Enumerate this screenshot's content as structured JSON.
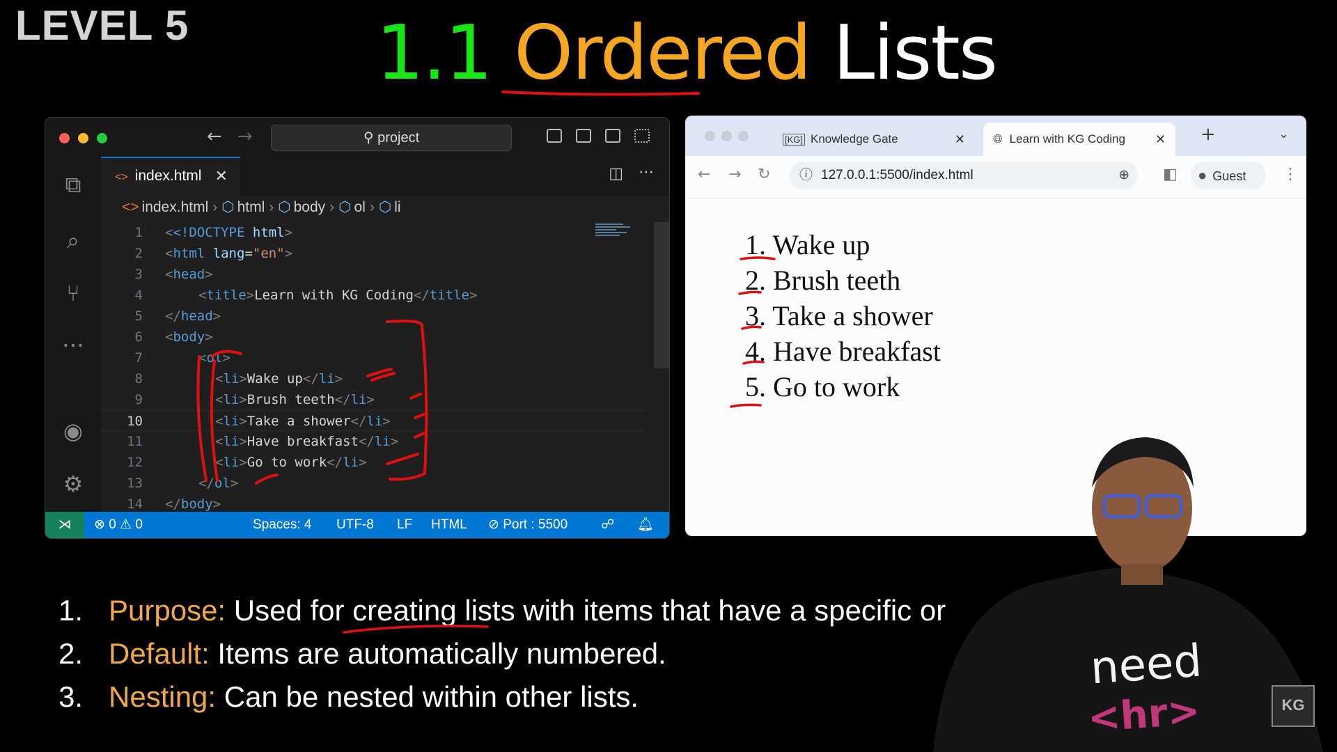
{
  "slide": {
    "level": "LEVEL 5",
    "title_number": "1.1",
    "title_word1": "Ordered",
    "title_word2": "Lists"
  },
  "editor": {
    "search_label": "project",
    "tab_label": "index.html",
    "breadcrumb": [
      "index.html",
      "html",
      "body",
      "ol",
      "li"
    ],
    "current_line": 10,
    "lines": [
      {
        "n": "1"
      },
      {
        "n": "2"
      },
      {
        "n": "3"
      },
      {
        "n": "4"
      },
      {
        "n": "5"
      },
      {
        "n": "6"
      },
      {
        "n": "7"
      },
      {
        "n": "8"
      },
      {
        "n": "9"
      },
      {
        "n": "10"
      },
      {
        "n": "11"
      },
      {
        "n": "12"
      },
      {
        "n": "13"
      },
      {
        "n": "14"
      }
    ],
    "code": {
      "doctype": "<!DOCTYPE",
      "doctype_html": "html",
      "html_open": "html",
      "lang_attr": "lang",
      "lang_val": "\"en\"",
      "head": "head",
      "title_tag": "title",
      "title_text": "Learn with KG Coding",
      "body": "body",
      "ol": "ol",
      "li": "li",
      "items": [
        "Wake up",
        "Brush teeth",
        "Take a shower",
        "Have breakfast",
        "Go to work"
      ]
    },
    "status": {
      "errors": "0",
      "warnings": "0",
      "spaces": "Spaces: 4",
      "encoding": "UTF-8",
      "eol": "LF",
      "language": "HTML",
      "port": "Port : 5500"
    }
  },
  "browser": {
    "tab1": "Knowledge Gate",
    "tab1_favicon": "[KG]",
    "tab2": "Learn with KG Coding",
    "url": "127.0.0.1:5500/index.html",
    "profile": "Guest",
    "rendered_list": [
      "1. Wake up",
      "2. Brush teeth",
      "3. Take a shower",
      "4. Have breakfast",
      "5. Go to work"
    ]
  },
  "notes": [
    {
      "num": "1.",
      "key": "Purpose:",
      "text": "Used for creating lists with items that have a specific or"
    },
    {
      "num": "2.",
      "key": "Default:",
      "text": "Items are automatically numbered."
    },
    {
      "num": "3.",
      "key": "Nesting:",
      "text": "Can be nested within other lists."
    }
  ],
  "overlay": {
    "shirt_line1": "need",
    "shirt_line2": "<hr>",
    "logo": "KG"
  },
  "colors": {
    "title_number": "#19e619",
    "title_accent": "#f5a623",
    "status_bar": "#0078d4",
    "annotation": "#e01010"
  }
}
